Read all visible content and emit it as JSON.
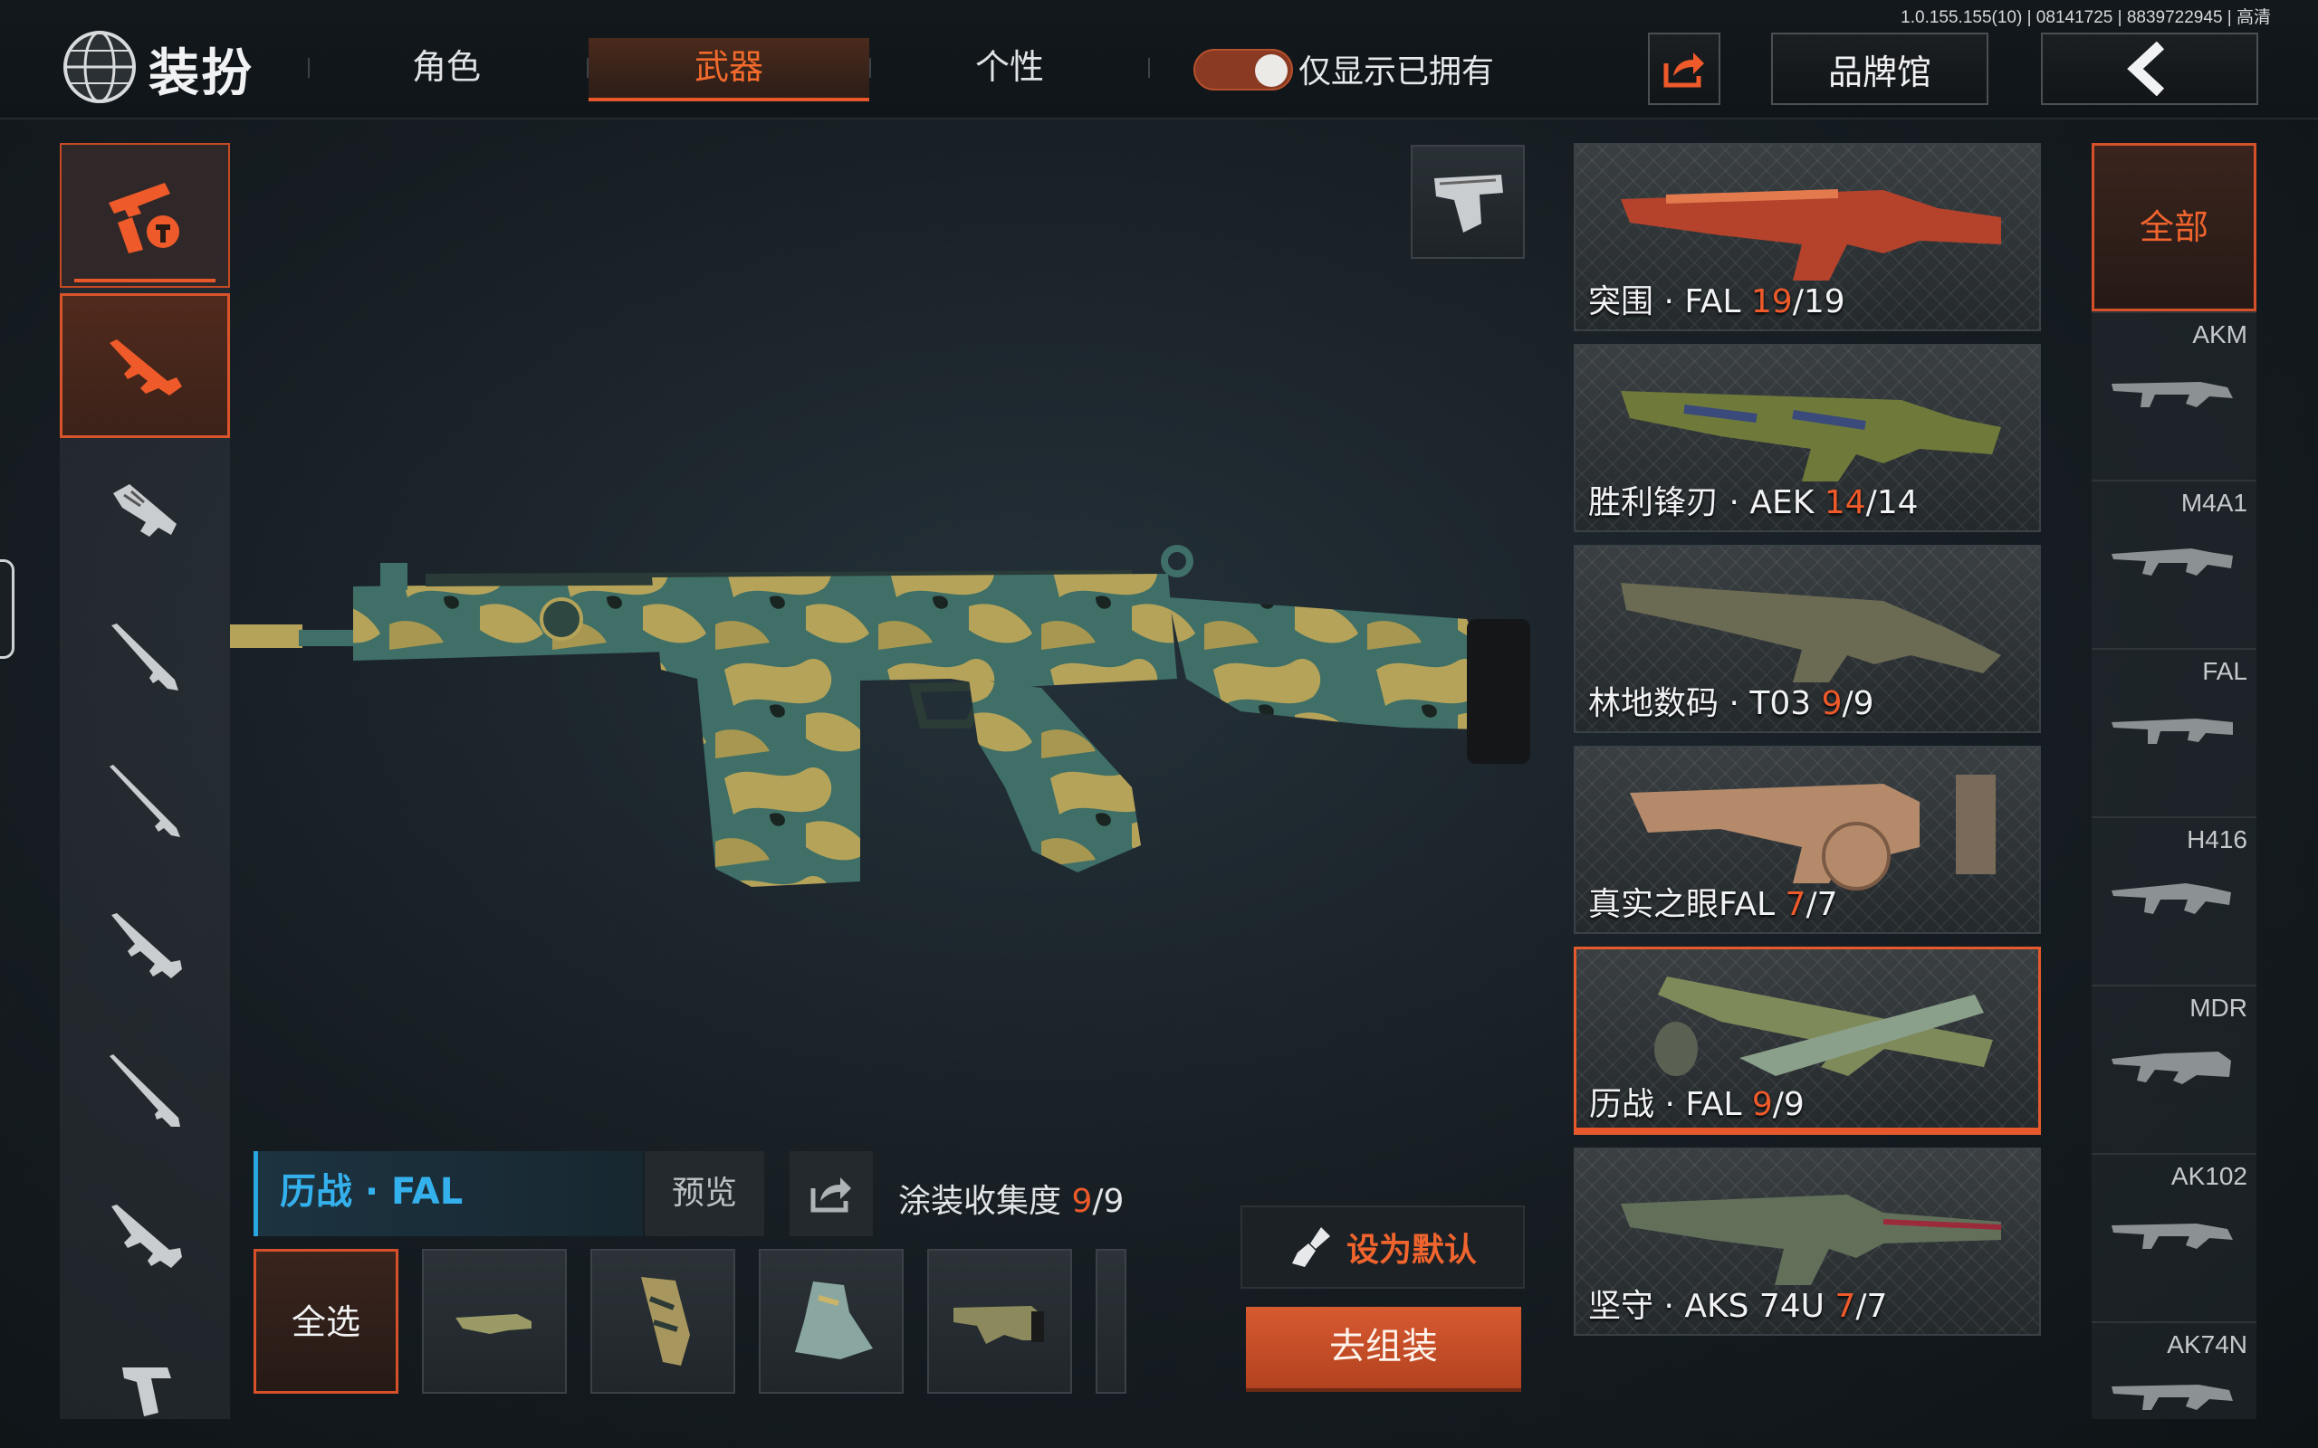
{
  "header": {
    "title": "装扮",
    "version": "1.0.155.155(10) | 08141725 | 8839722945 | 高清",
    "tabs": [
      {
        "label": "角色",
        "active": false
      },
      {
        "label": "武器",
        "active": true
      },
      {
        "label": "个性",
        "active": false
      }
    ],
    "owned_toggle_label": "仅显示已拥有",
    "owned_toggle_on": true,
    "brand_button": "品牌馆"
  },
  "left_rail": {
    "items": [
      {
        "icon": "weapon-category-icon",
        "state": "top"
      },
      {
        "icon": "assault-rifle-icon",
        "state": "selected"
      },
      {
        "icon": "smg-icon",
        "state": "normal"
      },
      {
        "icon": "shotgun-icon",
        "state": "normal"
      },
      {
        "icon": "sniper-rifle-icon",
        "state": "normal"
      },
      {
        "icon": "dmr-icon",
        "state": "normal"
      },
      {
        "icon": "bolt-rifle-icon",
        "state": "normal"
      },
      {
        "icon": "lmg-icon",
        "state": "normal"
      },
      {
        "icon": "pistol-icon",
        "state": "normal"
      }
    ]
  },
  "current": {
    "skin_name": "历战 · FAL",
    "preview_label": "预览",
    "collection_label": "涂装收集度",
    "collection_owned": "9",
    "collection_total": "/9",
    "select_all_label": "全选",
    "set_default_label": "设为默认",
    "assemble_label": "去组装"
  },
  "skins": [
    {
      "name": "突围 · FAL ",
      "owned": "19",
      "total": "/19",
      "tint": "#b5432c",
      "selected": false
    },
    {
      "name": "胜利锋刃 · AEK ",
      "owned": "14",
      "total": "/14",
      "tint": "#6f7a3a",
      "selected": false
    },
    {
      "name": "林地数码 · T03 ",
      "owned": "9",
      "total": "/9",
      "tint": "#6b6a52",
      "selected": false
    },
    {
      "name": "真实之眼FAL ",
      "owned": "7",
      "total": "/7",
      "tint": "#b48a6a",
      "selected": false
    },
    {
      "name": "历战 · FAL ",
      "owned": "9",
      "total": "/9",
      "tint": "#7f8a5a",
      "selected": true
    },
    {
      "name": "坚守 · AKS 74U ",
      "owned": "7",
      "total": "/7",
      "tint": "#62705a",
      "selected": false
    }
  ],
  "weapon_filter": {
    "all_label": "全部",
    "items": [
      "AKM",
      "M4A1",
      "FAL",
      "H416",
      "MDR",
      "AK102",
      "AK74N"
    ]
  },
  "colors": {
    "accent": "#e8572a",
    "highlight_blue": "#34b1ec",
    "camo_green": "#3f6f66",
    "camo_tan": "#b6a35a"
  }
}
